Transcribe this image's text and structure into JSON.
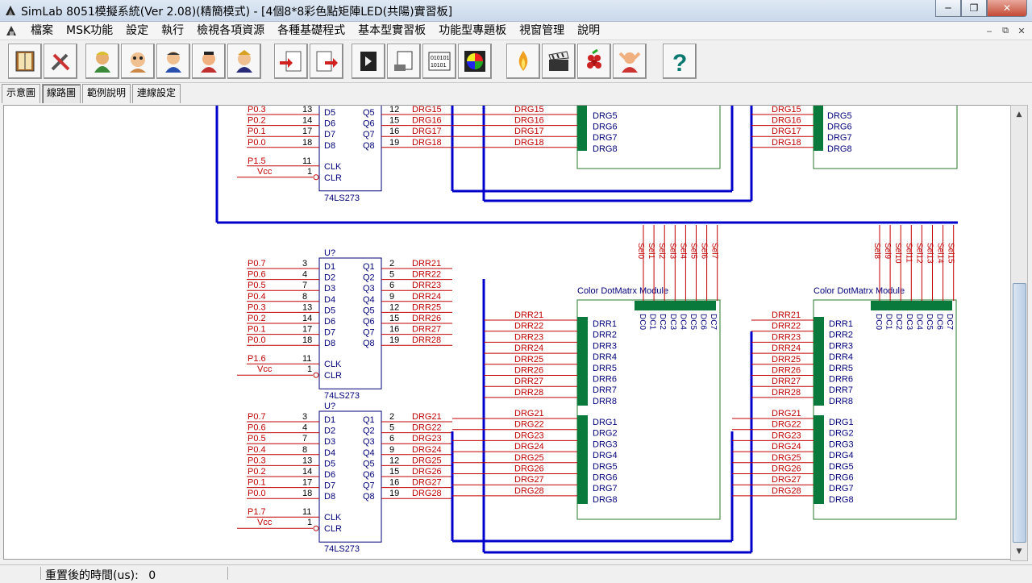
{
  "window": {
    "title": "SimLab 8051模擬系統(Ver  2.08)(精簡模式) - [4個8*8彩色點矩陣LED(共陽)實習板]",
    "minimize": "─",
    "maximize": "❐",
    "close": "✕"
  },
  "menu": {
    "items": [
      "檔案",
      "MSK功能",
      "設定",
      "執行",
      "檢視各項資源",
      "各種基礎程式",
      "基本型實習板",
      "功能型專題板",
      "視窗管理",
      "說明"
    ],
    "mdi_minimize": "‒",
    "mdi_restore": "⧉",
    "mdi_close": "✕"
  },
  "toolbar": {
    "buttons": [
      "book-icon",
      "tools-icon",
      "char1-icon",
      "char2-icon",
      "char3-icon",
      "char4-icon",
      "char5-icon",
      "load-hex-icon",
      "load-hex2-icon",
      "chip-icon",
      "document-icon",
      "binary-icon",
      "color-wheel-icon",
      "fire-icon",
      "clapper-icon",
      "grapes-icon",
      "hand-icon",
      "help-icon"
    ]
  },
  "tabs": [
    "示意圖",
    "線路圖",
    "範例說明",
    "連線設定"
  ],
  "active_tab": "線路圖",
  "schematic": {
    "chip_name": "74LS273",
    "chip_ref": "U?",
    "inputs": [
      "D1",
      "D2",
      "D3",
      "D4",
      "D5",
      "D6",
      "D7",
      "D8"
    ],
    "outputs": [
      "Q1",
      "Q2",
      "Q3",
      "Q4",
      "Q5",
      "Q6",
      "Q7",
      "Q8"
    ],
    "ports": [
      "P0.7",
      "P0.6",
      "P0.5",
      "P0.4",
      "P0.3",
      "P0.2",
      "P0.1",
      "P0.0"
    ],
    "in_pins": [
      "3",
      "4",
      "7",
      "8",
      "13",
      "14",
      "17",
      "18"
    ],
    "out_pins": [
      "2",
      "5",
      "6",
      "9",
      "12",
      "15",
      "16",
      "19"
    ],
    "clk_label": "CLK",
    "clr_label": "CLR",
    "clk_pin": "11",
    "clr_pin": "1",
    "vcc": "Vcc",
    "top_partial": {
      "ports": [
        "P0.3",
        "P0.2",
        "P0.1",
        "P0.0"
      ],
      "in_pins": [
        "13",
        "14",
        "17",
        "18"
      ],
      "inputs": [
        "D5",
        "D6",
        "D7",
        "D8"
      ],
      "outputs": [
        "Q5",
        "Q6",
        "Q7",
        "Q8"
      ],
      "out_pins": [
        "12",
        "15",
        "16",
        "19"
      ],
      "clk_port": "P1.5",
      "nets": [
        "DRG15",
        "DRG16",
        "DRG17",
        "DRG18"
      ],
      "mod_labels": [
        "DRG5",
        "DRG6",
        "DRG7",
        "DRG8"
      ]
    },
    "mid": {
      "clk_port": "P1.6",
      "nets": [
        "DRR21",
        "DRR22",
        "DRR23",
        "DRR24",
        "DRR25",
        "DRR26",
        "DRR27",
        "DRR28"
      ]
    },
    "bot": {
      "clk_port": "P1.7",
      "nets": [
        "DRG21",
        "DRG22",
        "DRG23",
        "DRG24",
        "DRG25",
        "DRG26",
        "DRG27",
        "DRG28"
      ]
    },
    "module_title": "Color DotMatrx Module",
    "red_labels": [
      "DRR1",
      "DRR2",
      "DRR3",
      "DRR4",
      "DRR5",
      "DRR6",
      "DRR7",
      "DRR8"
    ],
    "green_labels": [
      "DRG1",
      "DRG2",
      "DRG3",
      "DRG4",
      "DRG5",
      "DRG6",
      "DRG7",
      "DRG8"
    ],
    "col_labels": [
      "DC0",
      "DC1",
      "DC2",
      "DC3",
      "DC4",
      "DC5",
      "DC6",
      "DC7"
    ],
    "sel_left": [
      "Sel0",
      "Sel1",
      "Sel2",
      "Sel3",
      "Sel4",
      "Sel5",
      "Sel6",
      "Sel7"
    ],
    "sel_right": [
      "Sel8",
      "Sel9",
      "Sel10",
      "Sel11",
      "Sel12",
      "Sel13",
      "Sel14",
      "Sel15"
    ]
  },
  "status": {
    "label": "重置後的時間(us):",
    "value": "0"
  },
  "colors": {
    "wire_red": "#c00000",
    "bus_blue": "#0000cc",
    "chip_blue": "#00007a",
    "module_green": "#0a7a3c",
    "module_outline": "#2a7a2a"
  }
}
